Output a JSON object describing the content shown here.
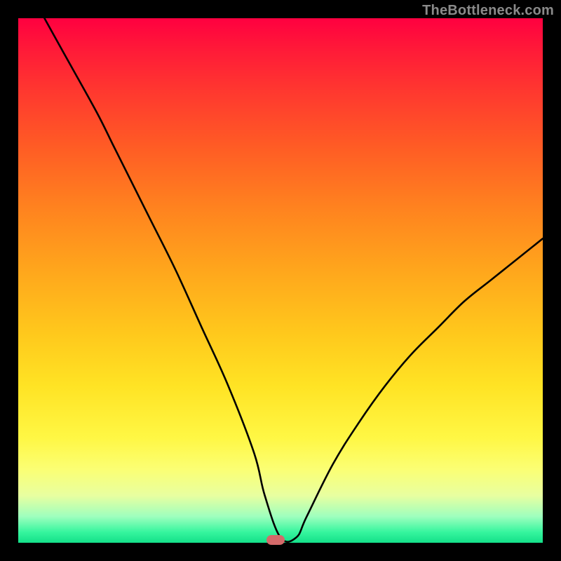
{
  "watermark_text": "TheBottleneck.com",
  "colors": {
    "frame": "#000000",
    "curve": "#000000",
    "marker": "#d46a6a",
    "gradient_top": "#ff0040",
    "gradient_bottom": "#14e089"
  },
  "chart_data": {
    "type": "line",
    "title": "",
    "xlabel": "",
    "ylabel": "",
    "xlim": [
      0,
      100
    ],
    "ylim": [
      0,
      100
    ],
    "legend": false,
    "grid": false,
    "annotations": [
      {
        "text": "TheBottleneck.com",
        "position": "top-right"
      }
    ],
    "marker": {
      "x": 49,
      "y": 0.5,
      "shape": "rounded-rect"
    },
    "series": [
      {
        "name": "bottleneck-curve",
        "x": [
          5,
          10,
          15,
          18,
          20,
          25,
          30,
          35,
          40,
          45,
          47,
          50,
          53,
          55,
          60,
          65,
          70,
          75,
          80,
          85,
          90,
          95,
          100
        ],
        "y": [
          100,
          91,
          82,
          76,
          72,
          62,
          52,
          41,
          30,
          17,
          9,
          1,
          1,
          5,
          15,
          23,
          30,
          36,
          41,
          46,
          50,
          54,
          58
        ]
      }
    ]
  }
}
